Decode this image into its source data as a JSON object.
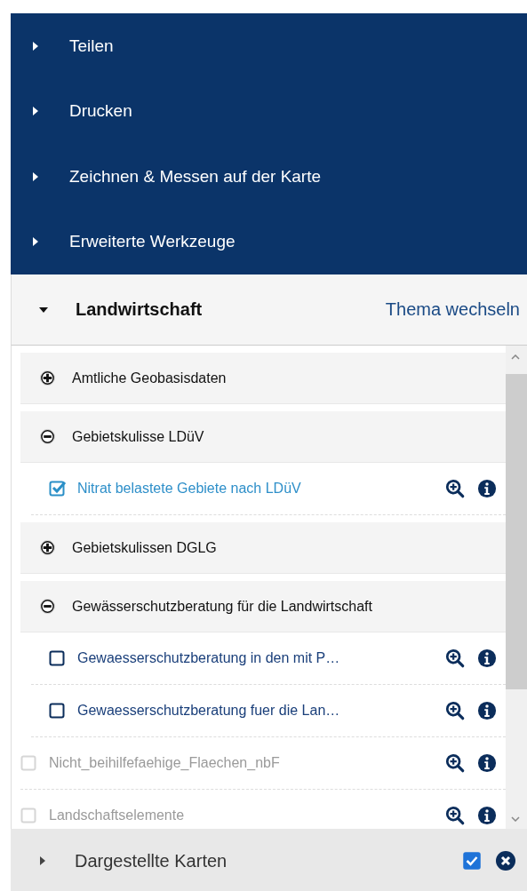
{
  "tools": [
    {
      "label": "Teilen",
      "expanded": false
    },
    {
      "label": "Drucken",
      "expanded": false
    },
    {
      "label": "Zeichnen & Messen auf der Karte",
      "expanded": false
    },
    {
      "label": "Erweiterte Werkzeuge",
      "expanded": false
    }
  ],
  "theme": {
    "title": "Landwirtschaft",
    "expanded": true,
    "switch_link": "Thema wechseln"
  },
  "layers": [
    {
      "kind": "group",
      "label": "Amtliche Geobasisdaten",
      "expanded": false
    },
    {
      "kind": "group",
      "label": "Gebietskulisse LDüV",
      "expanded": true,
      "children": [
        {
          "kind": "layer",
          "label": "Nitrat belastete Gebiete nach LDüV",
          "checked": true,
          "disabled": false
        }
      ]
    },
    {
      "kind": "group",
      "label": "Gebietskulissen DGLG",
      "expanded": false
    },
    {
      "kind": "group",
      "label": "Gewässerschutzberatung für die Landwirtschaft",
      "expanded": true,
      "children": [
        {
          "kind": "layer",
          "label": "Gewaesserschutzberatung in den mit P…",
          "checked": false,
          "disabled": false
        },
        {
          "kind": "layer",
          "label": "Gewaesserschutzberatung fuer die Lan…",
          "checked": false,
          "disabled": false
        }
      ]
    },
    {
      "kind": "layer",
      "label": "Nicht_beihilfefaehige_Flaechen_nbF",
      "checked": false,
      "disabled": true
    },
    {
      "kind": "layer",
      "label": "Landschaftselemente",
      "checked": false,
      "disabled": true
    }
  ],
  "footer": {
    "title": "Dargestellte Karten",
    "expanded": false,
    "checked": true
  }
}
